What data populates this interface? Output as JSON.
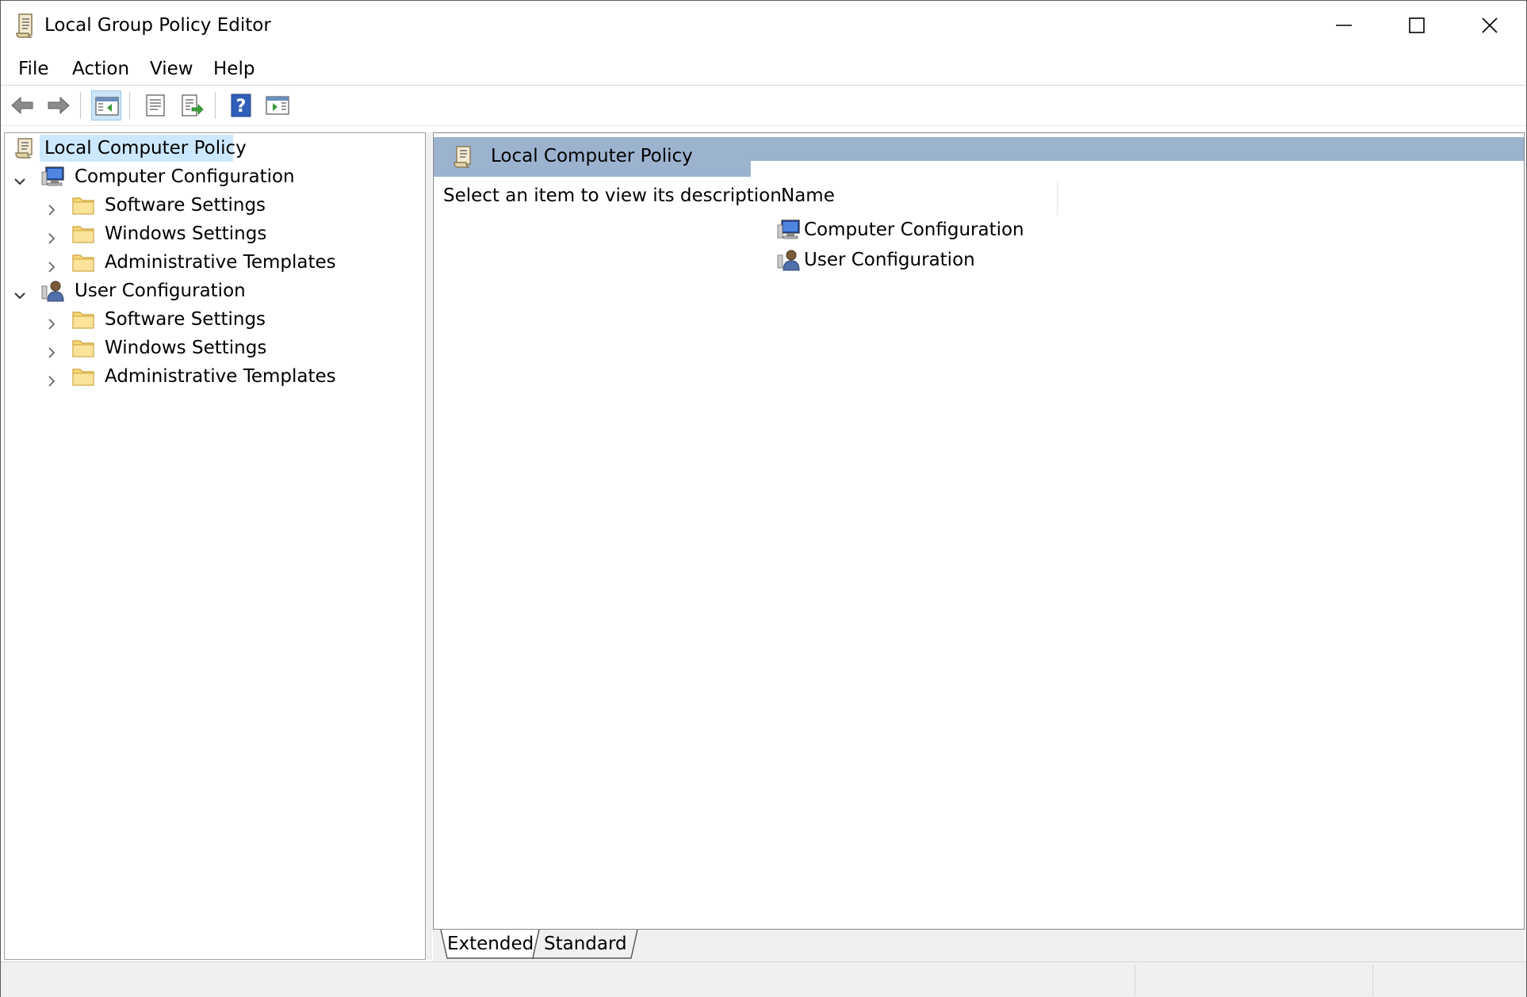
{
  "window": {
    "title": "Local Group Policy Editor"
  },
  "menu": {
    "items": [
      {
        "label": "File"
      },
      {
        "label": "Action"
      },
      {
        "label": "View"
      },
      {
        "label": "Help"
      }
    ]
  },
  "toolbar": {
    "buttons": [
      {
        "icon": "back-arrow-icon"
      },
      {
        "icon": "forward-arrow-icon"
      },
      {
        "icon": "show-hide-console-tree-icon",
        "active": true
      },
      {
        "icon": "properties-icon"
      },
      {
        "icon": "export-list-icon"
      },
      {
        "icon": "help-icon"
      },
      {
        "icon": "show-hide-action-pane-icon"
      }
    ]
  },
  "tree": {
    "root": {
      "label": "Local Computer Policy",
      "icon": "policy-scroll-icon",
      "selected": true
    },
    "nodes": [
      {
        "label": "Computer Configuration",
        "icon": "computer-icon",
        "expanded": true,
        "children": [
          {
            "label": "Software Settings",
            "icon": "folder-icon"
          },
          {
            "label": "Windows Settings",
            "icon": "folder-icon"
          },
          {
            "label": "Administrative Templates",
            "icon": "folder-icon"
          }
        ]
      },
      {
        "label": "User Configuration",
        "icon": "user-icon",
        "expanded": true,
        "children": [
          {
            "label": "Software Settings",
            "icon": "folder-icon"
          },
          {
            "label": "Windows Settings",
            "icon": "folder-icon"
          },
          {
            "label": "Administrative Templates",
            "icon": "folder-icon"
          }
        ]
      }
    ]
  },
  "details": {
    "title": "Local Computer Policy",
    "description": "Select an item to view its description.",
    "column_header": "Name",
    "items": [
      {
        "label": "Computer Configuration",
        "icon": "computer-icon"
      },
      {
        "label": "User Configuration",
        "icon": "user-icon"
      }
    ]
  },
  "tabs": [
    {
      "label": "Extended",
      "active": true
    },
    {
      "label": "Standard",
      "active": false
    }
  ],
  "colors": {
    "header_band": "#9cb3d0",
    "selection": "#cce8ff",
    "folder": "#f8d775"
  }
}
